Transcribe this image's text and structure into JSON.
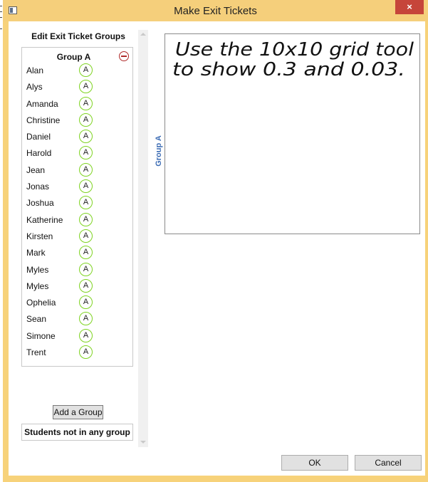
{
  "window": {
    "title": "Make Exit Tickets",
    "close_glyph": "×",
    "app_icon": "window-app-icon"
  },
  "left_panel": {
    "title": "Edit Exit Ticket Groups",
    "group": {
      "name": "Group A",
      "remove_icon": "remove-circle-icon",
      "students": [
        {
          "name": "Alan",
          "badge": "A"
        },
        {
          "name": "Alys",
          "badge": "A"
        },
        {
          "name": "Amanda",
          "badge": "A"
        },
        {
          "name": "Christine",
          "badge": "A"
        },
        {
          "name": "Daniel",
          "badge": "A"
        },
        {
          "name": "Harold",
          "badge": "A"
        },
        {
          "name": "Jean",
          "badge": "A"
        },
        {
          "name": "Jonas",
          "badge": "A"
        },
        {
          "name": "Joshua",
          "badge": "A"
        },
        {
          "name": "Katherine",
          "badge": "A"
        },
        {
          "name": "Kirsten",
          "badge": "A"
        },
        {
          "name": "Mark",
          "badge": "A"
        },
        {
          "name": "Myles",
          "badge": "A"
        },
        {
          "name": "Myles",
          "badge": "A"
        },
        {
          "name": "Ophelia",
          "badge": "A"
        },
        {
          "name": "Sean",
          "badge": "A"
        },
        {
          "name": "Simone",
          "badge": "A"
        },
        {
          "name": "Trent",
          "badge": "A"
        }
      ]
    },
    "add_group_label": "Add a Group",
    "ungrouped_label": "Students not in any group"
  },
  "editor": {
    "group_label": "Group A",
    "handwritten_text": [
      "Use the 10x10 grid tool",
      "to show 0.3 and 0.03."
    ]
  },
  "footer": {
    "ok_label": "OK",
    "cancel_label": "Cancel"
  },
  "colors": {
    "title_bar": "#f5cf7b",
    "close_button": "#c6453a",
    "badge_border": "#7ed321",
    "remove_icon": "#b02a2a",
    "group_label": "#3d6db5"
  }
}
